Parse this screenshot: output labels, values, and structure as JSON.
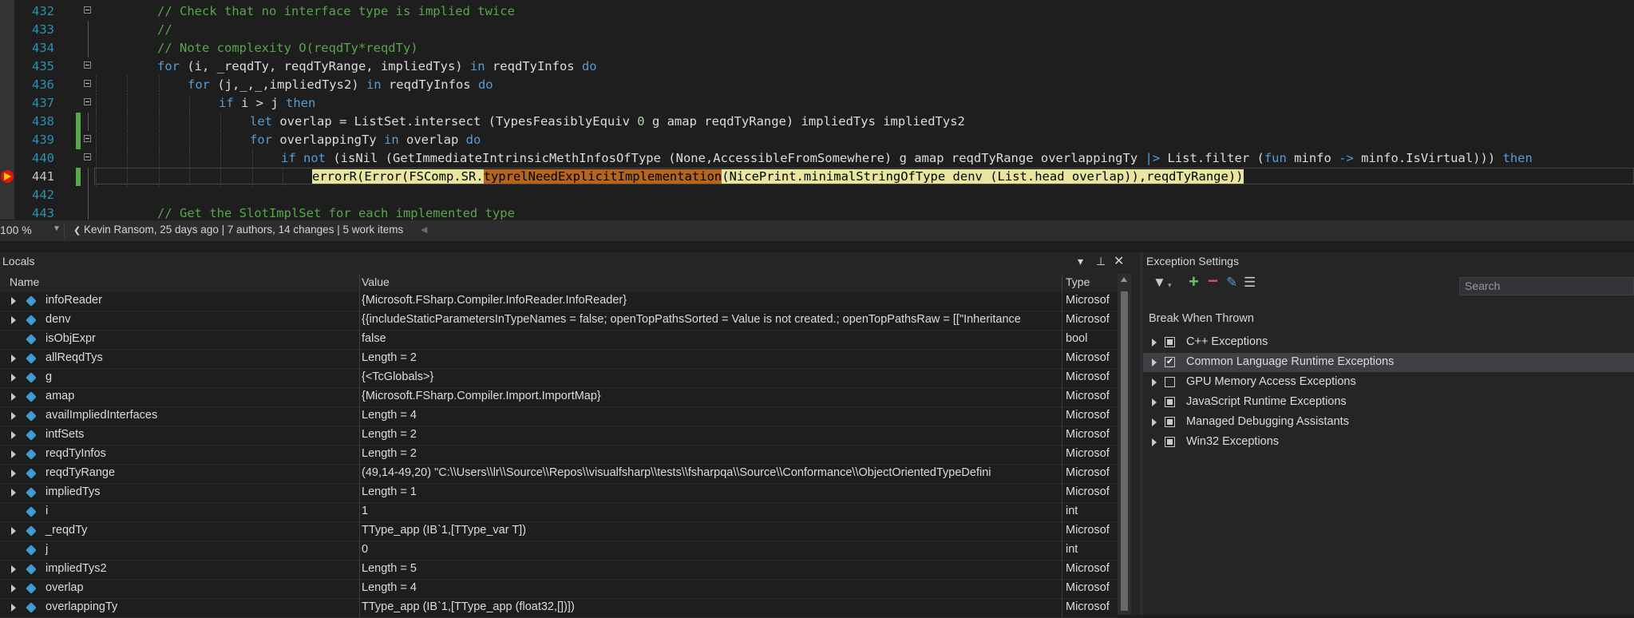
{
  "editor": {
    "lines": [
      {
        "n": "432",
        "code": "// Check that no interface type is implied twice"
      },
      {
        "n": "433",
        "code": "//"
      },
      {
        "n": "434",
        "code": "// Note complexity O(reqdTy*reqdTy)"
      },
      {
        "n": "435",
        "code": "for (i, _reqdTy, reqdTyRange, impliedTys) in reqdTyInfos do"
      },
      {
        "n": "436",
        "code": "for (j,_,_,impliedTys2) in reqdTyInfos do"
      },
      {
        "n": "437",
        "code": "if i > j then"
      },
      {
        "n": "438",
        "code": "let overlap = ListSet.intersect (TypesFeasiblyEquiv 0 g amap reqdTyRange) impliedTys impliedTys2"
      },
      {
        "n": "439",
        "code": "for overlappingTy in overlap do"
      },
      {
        "n": "440",
        "code": "if not (isNil (GetImmediateIntrinsicMethInfosOfType (None,AccessibleFromSomewhere) g amap reqdTyRange overlappingTy |> List.filter (fun minfo -> minfo.IsVirtual))) then"
      },
      {
        "n": "441",
        "code": "errorR(Error(FSComp.SR.typrelNeedExplicitImplementation(NicePrint.minimalStringOfType denv (List.head overlap)),reqdTyRange))"
      },
      {
        "n": "442",
        "code": ""
      },
      {
        "n": "443",
        "code": "// Get the SlotImplSet for each implemented type"
      }
    ],
    "line441_parts": {
      "indent": "",
      "p1": "errorR(Error(FSComp.SR.",
      "p2": "typrelNeedExplicitImplementation",
      "p3": "(NicePrint.minimalStringOfType denv (List.head overlap)),reqdTyRange))"
    }
  },
  "statusbar": {
    "zoom": "100 %",
    "codelens": "Kevin Ransom, 25 days ago | 7 authors, 14 changes | 5 work items"
  },
  "locals": {
    "title": "Locals",
    "columns": {
      "name": "Name",
      "value": "Value",
      "type": "Type"
    },
    "rows": [
      {
        "name": "infoReader",
        "value": "{Microsoft.FSharp.Compiler.InfoReader.InfoReader}",
        "type": "Microsof",
        "exp": true
      },
      {
        "name": "denv",
        "value": "{{includeStaticParametersInTypeNames = false; openTopPathsSorted = Value is not created.; openTopPathsRaw =  [[\"Inheritance",
        "type": "Microsof",
        "exp": true
      },
      {
        "name": "isObjExpr",
        "value": "false",
        "type": "bool",
        "exp": false
      },
      {
        "name": "allReqdTys",
        "value": "Length = 2",
        "type": "Microsof",
        "exp": true
      },
      {
        "name": "g",
        "value": "{<TcGlobals>}",
        "type": "Microsof",
        "exp": true
      },
      {
        "name": "amap",
        "value": "{Microsoft.FSharp.Compiler.Import.ImportMap}",
        "type": "Microsof",
        "exp": true
      },
      {
        "name": "availImpliedInterfaces",
        "value": "Length = 4",
        "type": "Microsof",
        "exp": true
      },
      {
        "name": "intfSets",
        "value": "Length = 2",
        "type": "Microsof",
        "exp": true
      },
      {
        "name": "reqdTyInfos",
        "value": "Length = 2",
        "type": "Microsof",
        "exp": true
      },
      {
        "name": "reqdTyRange",
        "value": "(49,14-49,20) \"C:\\\\Users\\\\lr\\\\Source\\\\Repos\\\\visualfsharp\\\\tests\\\\fsharpqa\\\\Source\\\\Conformance\\\\ObjectOrientedTypeDefini",
        "type": "Microsof",
        "exp": true
      },
      {
        "name": "impliedTys",
        "value": "Length = 1",
        "type": "Microsof",
        "exp": true
      },
      {
        "name": "i",
        "value": "1",
        "type": "int",
        "exp": false
      },
      {
        "name": "_reqdTy",
        "value": "TType_app (IB`1,[TType_var T])",
        "type": "Microsof",
        "exp": true
      },
      {
        "name": "j",
        "value": "0",
        "type": "int",
        "exp": false
      },
      {
        "name": "impliedTys2",
        "value": "Length = 5",
        "type": "Microsof",
        "exp": true
      },
      {
        "name": "overlap",
        "value": "Length = 4",
        "type": "Microsof",
        "exp": true
      },
      {
        "name": "overlappingTy",
        "value": "TType_app (IB`1,[TType_app (float32,[])])",
        "type": "Microsof",
        "exp": true
      }
    ]
  },
  "exceptions": {
    "title": "Exception Settings",
    "search_placeholder": "Search",
    "break_header": "Break When Thrown",
    "items": [
      {
        "label": "C++ Exceptions",
        "state": "partial",
        "selected": false
      },
      {
        "label": "Common Language Runtime Exceptions",
        "state": "checked",
        "selected": true
      },
      {
        "label": "GPU Memory Access Exceptions",
        "state": "unchecked",
        "selected": false
      },
      {
        "label": "JavaScript Runtime Exceptions",
        "state": "partial",
        "selected": false
      },
      {
        "label": "Managed Debugging Assistants",
        "state": "partial",
        "selected": false
      },
      {
        "label": "Win32 Exceptions",
        "state": "partial",
        "selected": false
      }
    ]
  },
  "colors": {
    "keyword": "#569cd6",
    "comment": "#57a64a",
    "line_number": "#2b91af",
    "current_statement": "#e6e69e",
    "error_highlight": "#b5651d",
    "background": "#1e1e1e"
  },
  "icons": [
    "collapse-icon",
    "breakpoint-current-icon",
    "local-variable-icon",
    "filter-icon",
    "add-icon",
    "remove-icon",
    "edit-icon",
    "list-icon",
    "pin-icon",
    "dropdown-icon",
    "close-icon"
  ]
}
